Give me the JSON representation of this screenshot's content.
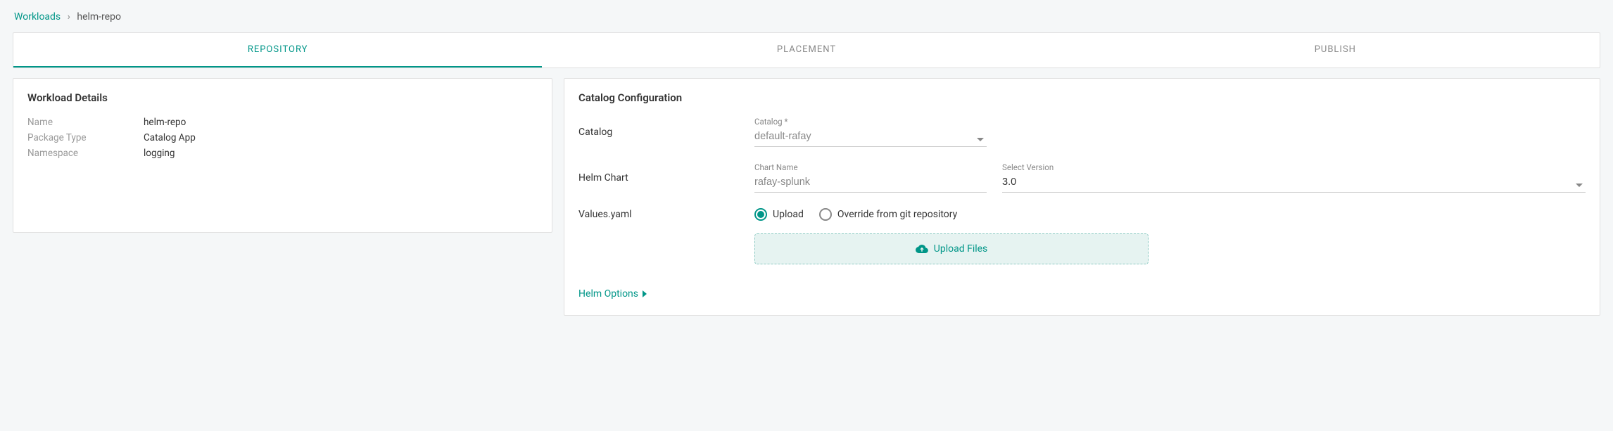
{
  "breadcrumb": {
    "root": "Workloads",
    "separator": "›",
    "current": "helm-repo"
  },
  "tabs": {
    "repository": "REPOSITORY",
    "placement": "PLACEMENT",
    "publish": "PUBLISH"
  },
  "workload_details": {
    "title": "Workload Details",
    "rows": {
      "name_label": "Name",
      "name_value": "helm-repo",
      "package_type_label": "Package Type",
      "package_type_value": "Catalog App",
      "namespace_label": "Namespace",
      "namespace_value": "logging"
    }
  },
  "catalog_config": {
    "title": "Catalog Configuration",
    "rows": {
      "catalog_label": "Catalog",
      "catalog_field_label": "Catalog *",
      "catalog_field_value": "default-rafay",
      "helm_chart_label": "Helm Chart",
      "chart_name_field_label": "Chart Name",
      "chart_name_field_value": "rafay-splunk",
      "version_field_label": "Select Version",
      "version_field_value": "3.0",
      "values_yaml_label": "Values.yaml",
      "radio_upload": "Upload",
      "radio_override": "Override from git repository",
      "upload_button": "Upload Files",
      "helm_options": "Helm Options"
    }
  }
}
